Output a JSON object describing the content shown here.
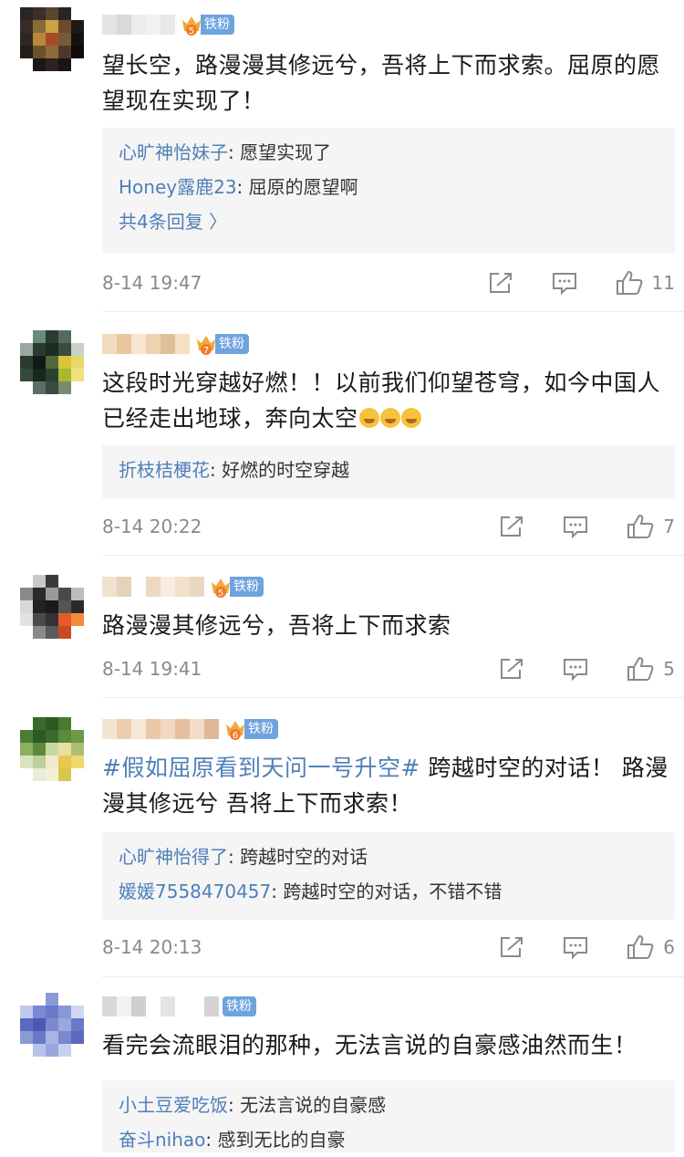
{
  "badge_label": "铁粉",
  "comments": [
    {
      "badge_level": "5",
      "text": "望长空，路漫漫其修远兮，吾将上下而求索。屈原的愿望现在实现了！",
      "replies": [
        {
          "name": "心旷神怡妹子",
          "text": ": 愿望实现了"
        },
        {
          "name": "Honey露鹿23",
          "text": ": 屈原的愿望啊"
        }
      ],
      "more": "共4条回复 〉",
      "time": "8-14 19:47",
      "likes": "11"
    },
    {
      "badge_level": "7",
      "text": "这段时光穿越好燃！！以前我们仰望苍穹，如今中国人已经走出地球，奔向太空",
      "replies": [
        {
          "name": "折枝桔梗花",
          "text": ": 好燃的时空穿越"
        }
      ],
      "time": "8-14 20:22",
      "likes": "7"
    },
    {
      "badge_level": "5",
      "text": "路漫漫其修远兮，吾将上下而求索",
      "time": "8-14 19:41",
      "likes": "5"
    },
    {
      "badge_level": "6",
      "topic": "#假如屈原看到天问一号升空#",
      "text": " 跨越时空的对话！ 路漫漫其修远兮  吾将上下而求索！",
      "replies": [
        {
          "name": "心旷神怡得了",
          "text": ": 跨越时空的对话"
        },
        {
          "name": "媛媛7558470457",
          "text": ": 跨越时空的对话，不错不错"
        }
      ],
      "time": "8-14 20:13",
      "likes": "6"
    },
    {
      "badge_level": "",
      "text": "看完会流眼泪的那种，无法言说的自豪感油然而生！",
      "replies": [
        {
          "name": "小土豆爱吃饭",
          "text": ": 无法言说的自豪感"
        },
        {
          "name": "奋斗nihao",
          "text": ": 感到无比的自豪"
        }
      ]
    }
  ],
  "colors": {
    "accent": "#4f7fb8",
    "badge": "#6fa3de",
    "reply_bg": "#f5f5f5",
    "meta": "#8a8a8a"
  }
}
